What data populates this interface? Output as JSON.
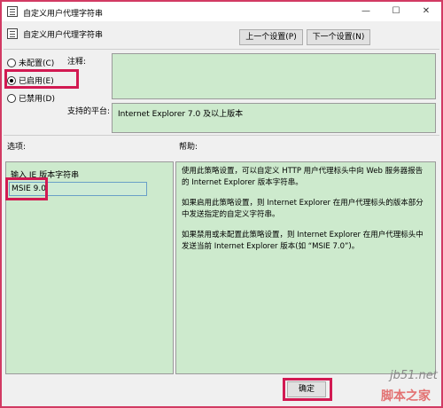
{
  "window": {
    "title": "自定义用户代理字符串",
    "minimize": "—",
    "maximize": "☐",
    "close": "✕"
  },
  "header": {
    "setting_name": "自定义用户代理字符串",
    "prev_button": "上一个设置(P)",
    "next_button": "下一个设置(N)"
  },
  "state": {
    "options": [
      {
        "label": "未配置(C)",
        "checked": false
      },
      {
        "label": "已启用(E)",
        "checked": true
      },
      {
        "label": "已禁用(D)",
        "checked": false
      }
    ]
  },
  "comment": {
    "label": "注释:",
    "value": ""
  },
  "platform": {
    "label": "支持的平台:",
    "value": "Internet Explorer 7.0 及以上版本"
  },
  "options_section": {
    "label": "选项:",
    "input_label": "输入 IE 版本字符串",
    "input_value": "MSIE 9.0"
  },
  "help_section": {
    "label": "帮助:",
    "paragraphs": [
      "使用此策略设置，可以自定义 HTTP 用户代理标头中向 Web 服务器报告的 Internet Explorer 版本字符串。",
      "如果启用此策略设置，则 Internet Explorer 在用户代理标头的版本部分中发送指定的自定义字符串。",
      "如果禁用或未配置此策略设置，则 Internet Explorer 在用户代理标头中发送当前 Internet Explorer 版本(如 “MSIE 7.0”)。"
    ]
  },
  "footer": {
    "ok_button": "确定"
  },
  "watermark": {
    "site": "jb51.net",
    "name": "脚本之家"
  },
  "colors": {
    "highlight": "#d21a52",
    "panel_green": "#cdeacd"
  }
}
